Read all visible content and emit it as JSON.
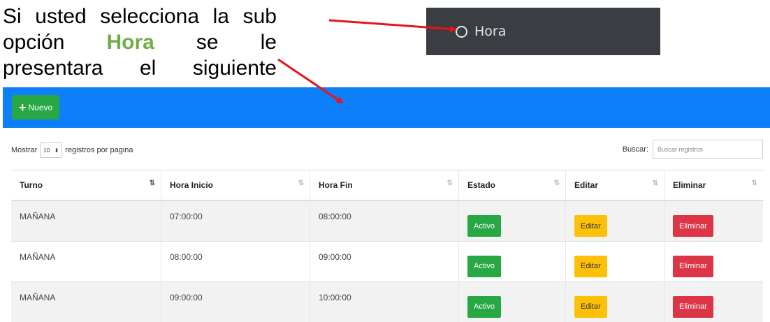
{
  "instruction": {
    "line1": [
      "Si",
      "usted",
      "selecciona",
      "la",
      "sub"
    ],
    "line2_opcion": "opción",
    "line2_highlight": "Hora",
    "line2_se": "se",
    "line2_le": "le",
    "line3": [
      "presentara",
      "el",
      "siguiente"
    ]
  },
  "menu_snippet": {
    "label": "Hora",
    "icon": "circle-outline-icon",
    "bg_color": "#3a3d41"
  },
  "header": {
    "new_button_label": "Nuevo",
    "new_button_icon": "plus-icon",
    "bar_color": "#0d7ff9"
  },
  "controls": {
    "show_label": "Mostrar",
    "page_size": "10",
    "records_label": "registros por pagina",
    "search_label": "Buscar:",
    "search_placeholder": "Buscar registros"
  },
  "table": {
    "columns": [
      "Turno",
      "Hora Inicio",
      "Hora Fin",
      "Estado",
      "Editar",
      "Eliminar"
    ],
    "rows": [
      {
        "turno": "MAÑANA",
        "hora_inicio": "07:00:00",
        "hora_fin": "08:00:00",
        "estado": "Activo",
        "editar": "Editar",
        "eliminar": "Eliminar"
      },
      {
        "turno": "MAÑANA",
        "hora_inicio": "08:00:00",
        "hora_fin": "09:00:00",
        "estado": "Activo",
        "editar": "Editar",
        "eliminar": "Eliminar"
      },
      {
        "turno": "MAÑANA",
        "hora_inicio": "09:00:00",
        "hora_fin": "10:00:00",
        "estado": "Activo",
        "editar": "Editar",
        "eliminar": "Eliminar"
      }
    ]
  },
  "colors": {
    "highlight_green": "#70ad47",
    "arrow_red": "#e8141b",
    "success": "#28a745",
    "warning": "#ffc107",
    "danger": "#dc3545"
  }
}
